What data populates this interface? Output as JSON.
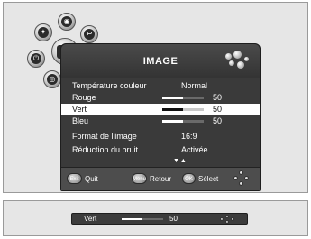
{
  "menu": {
    "title": "IMAGE",
    "rows": [
      {
        "label": "Température couleur",
        "value": "Normal"
      },
      {
        "label": "Rouge",
        "value": "50",
        "level": 0.5
      },
      {
        "label": "Vert",
        "value": "50",
        "level": 0.5
      },
      {
        "label": "Bleu",
        "value": "50",
        "level": 0.5
      },
      {
        "label": "Format de l'image",
        "value": "16:9"
      },
      {
        "label": "Réduction du bruit",
        "value": "Activée"
      }
    ],
    "selected_row": "Vert",
    "more_indicator": "▼▲"
  },
  "footer": {
    "exit_key": "Exit",
    "exit_label": "Quit",
    "menu_key": "Menu",
    "menu_label": "Retour",
    "ok_key": "OK",
    "ok_label": "Sélect"
  },
  "quickbar": {
    "label": "Vert",
    "value": "50",
    "level": 0.5
  },
  "icons": [
    "satellite-icon",
    "globe-icon",
    "return-icon",
    "power-icon",
    "tv-icon",
    "disc-icon",
    "nav-dpad-icon"
  ]
}
